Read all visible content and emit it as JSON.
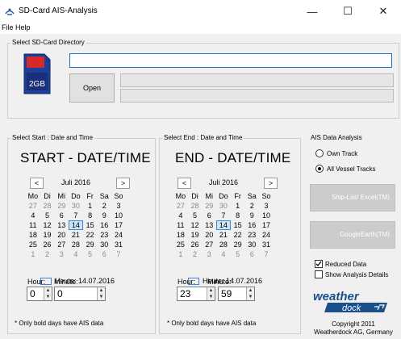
{
  "window": {
    "title": "SD-Card AIS-Analysis",
    "minimize": "—",
    "maximize": "☐",
    "close": "✕"
  },
  "menu": {
    "file": "File",
    "help": "Help"
  },
  "sd": {
    "group_label": "Select SD-Card Directory",
    "card_label": "2GB",
    "path_value": "",
    "open_label": "Open",
    "progress": [
      0,
      0
    ]
  },
  "start": {
    "group_label": "Select Start : Date and Time",
    "title": "START - DATE/TIME",
    "month": "Juli 2016",
    "today": "Heute: 14.07.2016",
    "hour_label": "Hour:",
    "minute_label": "Minute:",
    "hour": "0",
    "minute": "0",
    "note": "* Only bold days have AIS data"
  },
  "end": {
    "group_label": "Select End : Date and Time",
    "title": "END - DATE/TIME",
    "month": "Juli 2016",
    "today": "Heute: 14.07.2016",
    "hour_label": "Hour:",
    "minute_label": "Minute:",
    "hour": "23",
    "minute": "59",
    "note": "* Only bold days have AIS data"
  },
  "calendar": {
    "weekdays": [
      "Mo",
      "Di",
      "Mi",
      "Do",
      "Fr",
      "Sa",
      "So"
    ],
    "weeks": [
      [
        "27",
        "28",
        "29",
        "30",
        "1",
        "2",
        "3"
      ],
      [
        "4",
        "5",
        "6",
        "7",
        "8",
        "9",
        "10"
      ],
      [
        "11",
        "12",
        "13",
        "14",
        "15",
        "16",
        "17"
      ],
      [
        "18",
        "19",
        "20",
        "21",
        "22",
        "23",
        "24"
      ],
      [
        "25",
        "26",
        "27",
        "28",
        "29",
        "30",
        "31"
      ],
      [
        "1",
        "2",
        "3",
        "4",
        "5",
        "6",
        "7"
      ]
    ],
    "selected": "14",
    "prev": "<",
    "next": ">"
  },
  "ais": {
    "group_label": "AIS Data Analysis",
    "own_track": "Own Track",
    "all_vessel": "All Vessel Tracks",
    "selected_mode": "all_vessel",
    "shiplist_btn": "Ship-List/ Excel(TM)",
    "google_btn": "GoogleEarth(TM)",
    "reduced_data": "Reduced Data",
    "reduced_checked": true,
    "show_details": "Show Analysis Details",
    "details_checked": false,
    "logo_text": "weather dock",
    "copyright": "Copyright 2011",
    "company": "Weatherdock AG, Germany"
  },
  "colors": {
    "accent": "#1f73c6",
    "logo_blue": "#1a4f8a",
    "selection": "#cce4f7"
  }
}
